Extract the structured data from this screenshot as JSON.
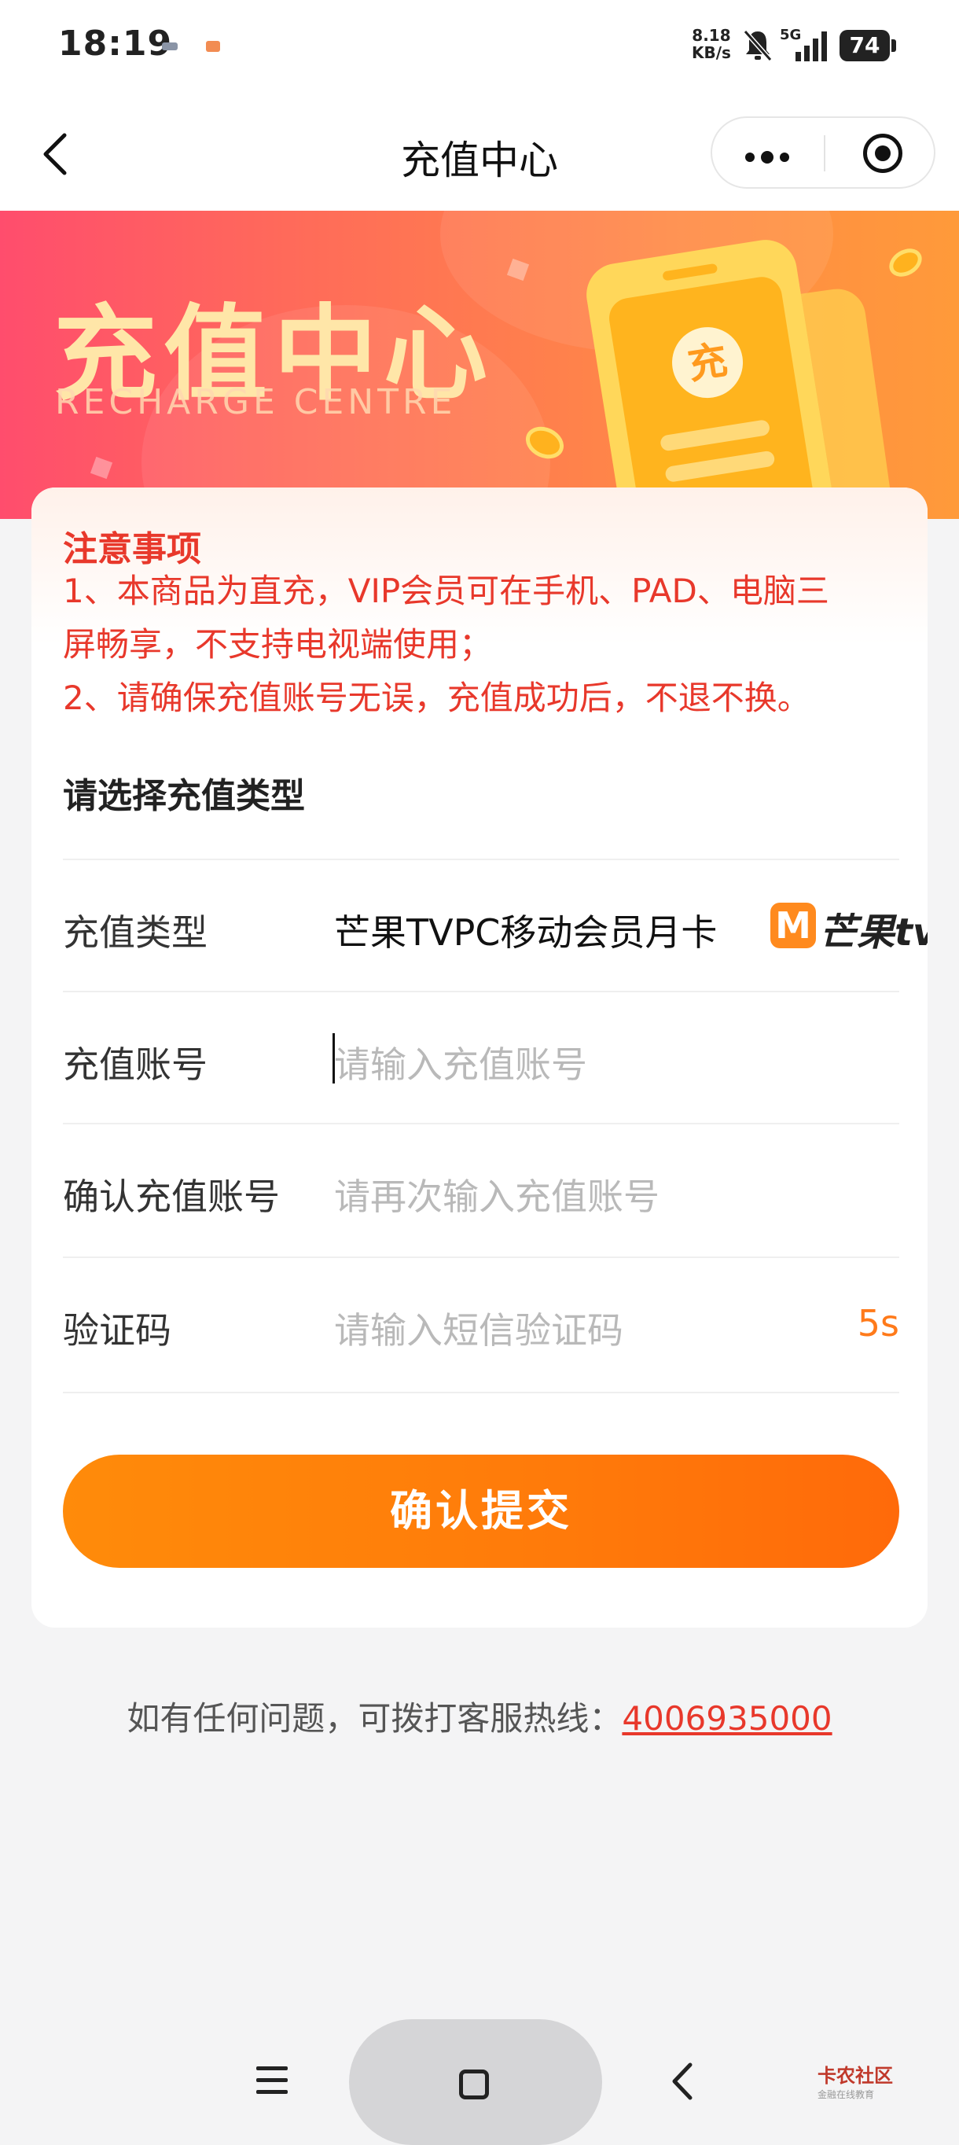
{
  "status_bar": {
    "time": "18:19",
    "speed_value": "8.18",
    "speed_unit": "KB/s",
    "network": "5G",
    "battery": "74"
  },
  "nav": {
    "title": "充值中心"
  },
  "banner": {
    "title": "充值中心",
    "subtitle": "RECHARGE CENTRE",
    "phone_glyph": "充"
  },
  "notice": {
    "title": "注意事项",
    "lines": [
      "1、本商品为直充，VIP会员可在手机、PAD、电脑三",
      "屏畅享，不支持电视端使用；",
      "2、请确保充值账号无误，充值成功后，不退不换。"
    ]
  },
  "form": {
    "section_title": "请选择充值类型",
    "type_label": "充值类型",
    "type_value": "芒果TVPC移动会员月卡",
    "brand_logo_text": "芒果tv",
    "account_label": "充值账号",
    "account_placeholder": "请输入充值账号",
    "confirm_label": "确认充值账号",
    "confirm_placeholder": "请再次输入充值账号",
    "code_label": "验证码",
    "code_placeholder": "请输入短信验证码",
    "countdown": "5s",
    "submit_label": "确认提交"
  },
  "hotline": {
    "text": "如有任何问题，可拨打客服热线：",
    "number": "4006935000"
  },
  "watermark": {
    "name": "卡农社区",
    "tagline": "金融在线教育"
  },
  "colors": {
    "accent": "#ff7a1a",
    "notice": "#e8382b",
    "banner_start": "#ff4d6d",
    "banner_end": "#ff9a3a"
  }
}
